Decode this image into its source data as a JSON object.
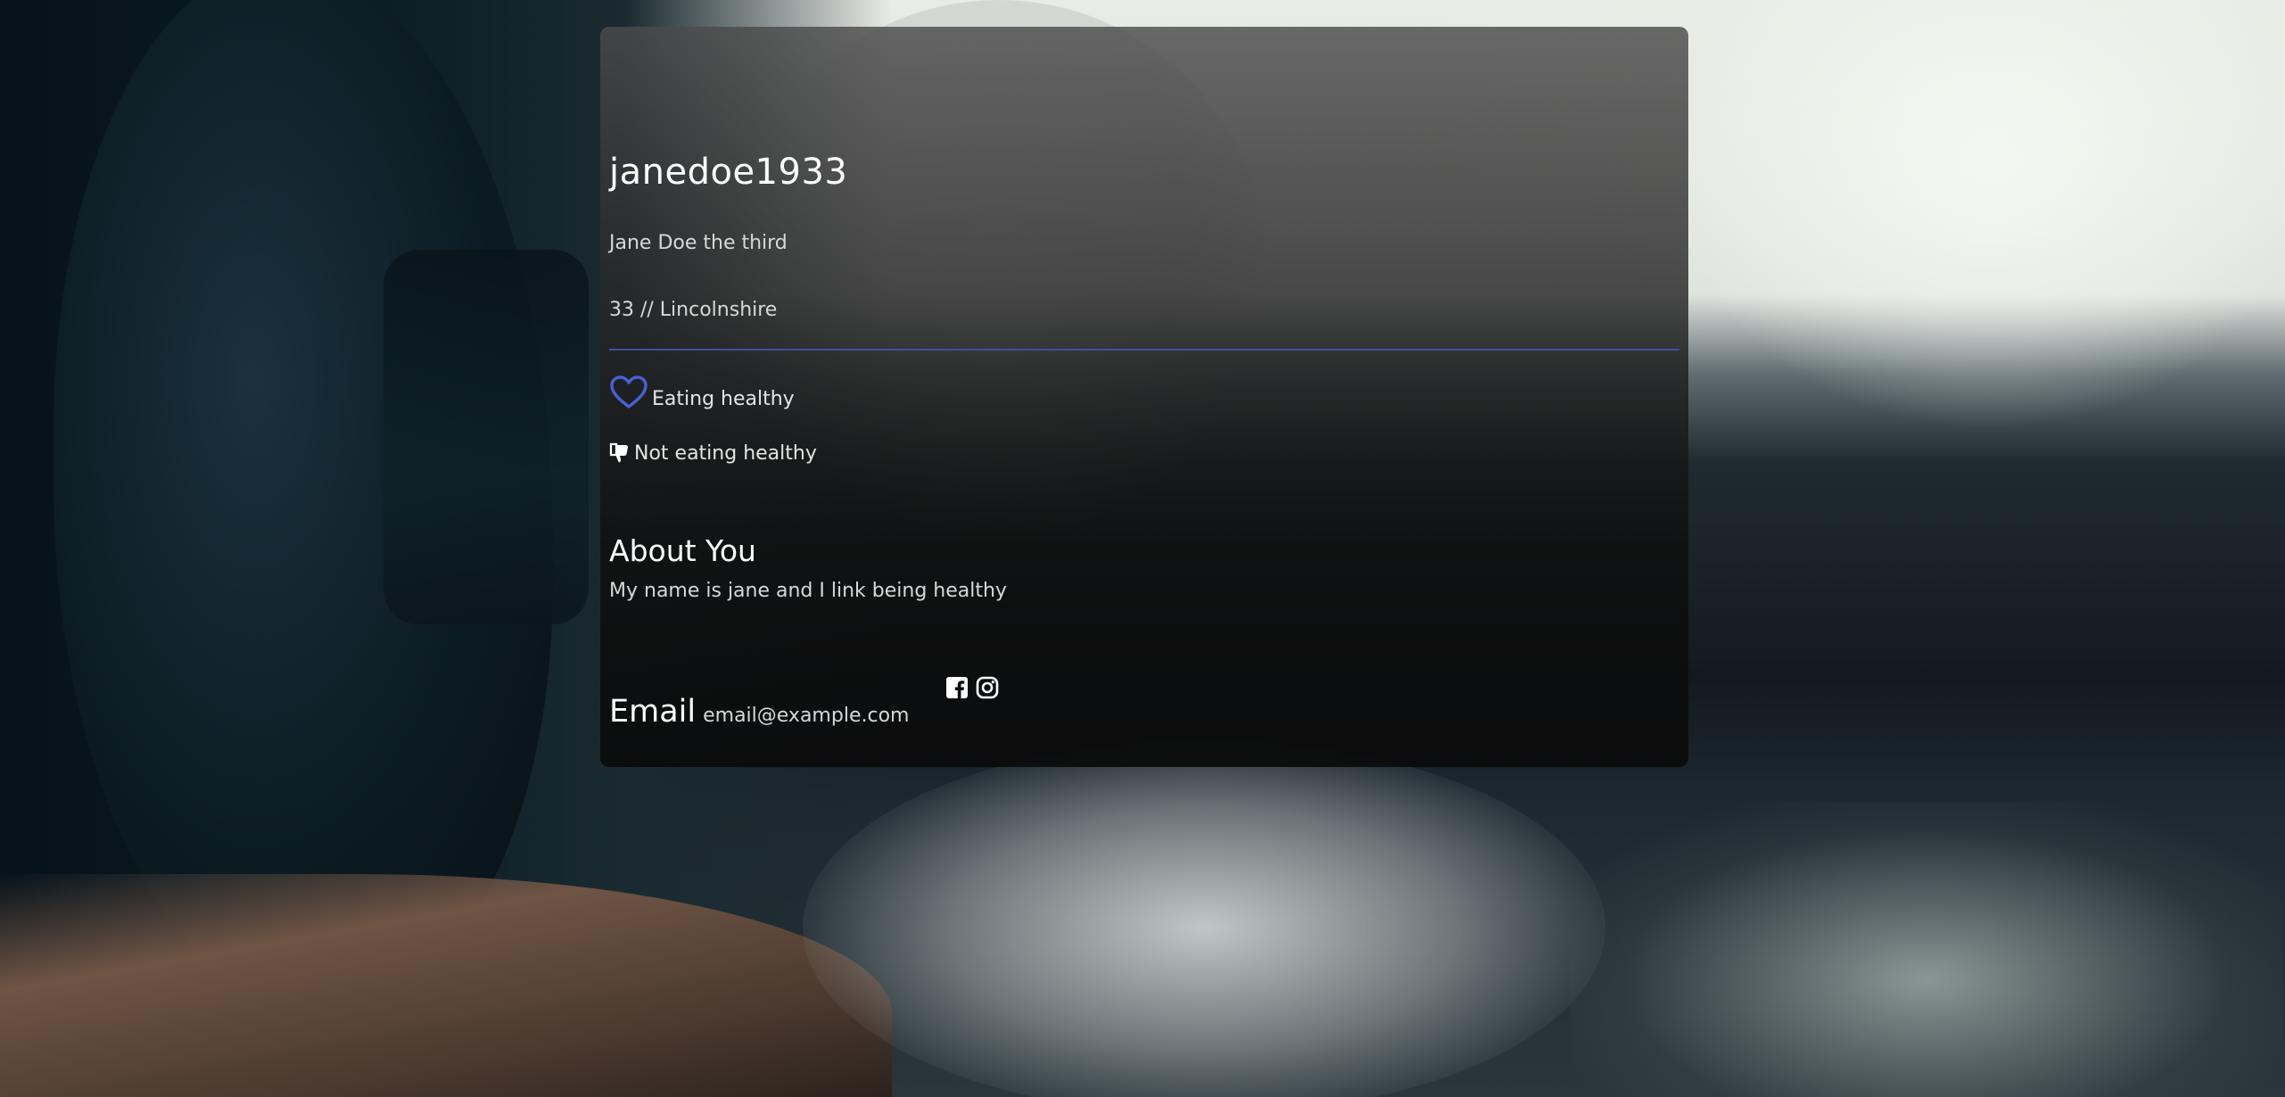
{
  "profile": {
    "username": "janedoe1933",
    "full_name": "Jane Doe the third",
    "age_location": "33 // Lincolnshire"
  },
  "goals": {
    "good_label": "Eating healthy",
    "bad_label": "Not eating healthy"
  },
  "about": {
    "title": "About You",
    "text": "My name is jane and I link being healthy"
  },
  "contact": {
    "email_label": "Email",
    "email_value": "email@example.com"
  },
  "icons": {
    "good": "heart-outline",
    "bad": "thumbs-down",
    "social": [
      "facebook-square",
      "instagram"
    ]
  },
  "colors": {
    "accent": "#4a5fd0",
    "divider": "#3f4fa0"
  }
}
